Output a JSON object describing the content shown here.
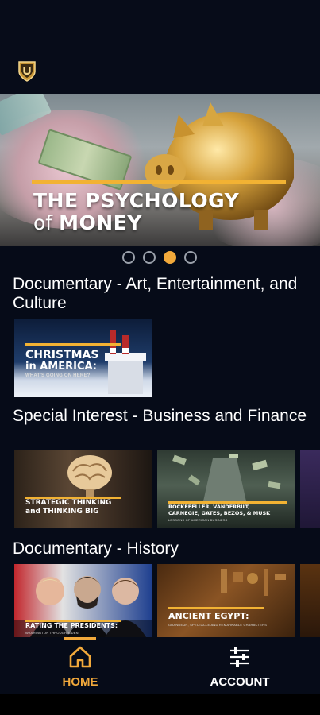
{
  "app": {
    "logo_icon": "shield-u-logo-icon",
    "accent": "#f2a93b"
  },
  "hero": {
    "title_line1": "THE PSYCHOLOGY",
    "title_line2_prefix": "of",
    "title_line2_bold": "MONEY",
    "carousel": {
      "total": 4,
      "active_index": 2
    }
  },
  "sections": [
    {
      "title": "Documentary - Art, Entertainment, and Culture",
      "cards": [
        {
          "title_line1": "CHRISTMAS",
          "title_line2": "in AMERICA:",
          "subtitle": "WHAT'S GOING ON HERE?"
        }
      ]
    },
    {
      "title": "Special Interest - Business and Finance",
      "cards": [
        {
          "title_line1": "STRATEGIC THINKING",
          "title_line2": "and THINKING BIG"
        },
        {
          "title_line1": "ROCKEFELLER, VANDERBILT,",
          "title_line2": "CARNEGIE, GATES, BEZOS, & MUSK",
          "subtitle": "LESSONS OF AMERICAN BUSINESS"
        }
      ]
    },
    {
      "title": "Documentary - History",
      "cards": [
        {
          "title_line1": "RATING THE PRESIDENTS:",
          "subtitle": "WASHINGTON THROUGH BIDEN"
        },
        {
          "title_line1": "ANCIENT EGYPT:",
          "subtitle": "GRANDEUR, SPECTACLE AND REMARKABLE CHARACTERS"
        }
      ]
    }
  ],
  "nav": {
    "home_label": "HOME",
    "home_icon": "house-icon",
    "account_label": "ACCOUNT",
    "account_icon": "sliders-icon",
    "active": "home"
  }
}
